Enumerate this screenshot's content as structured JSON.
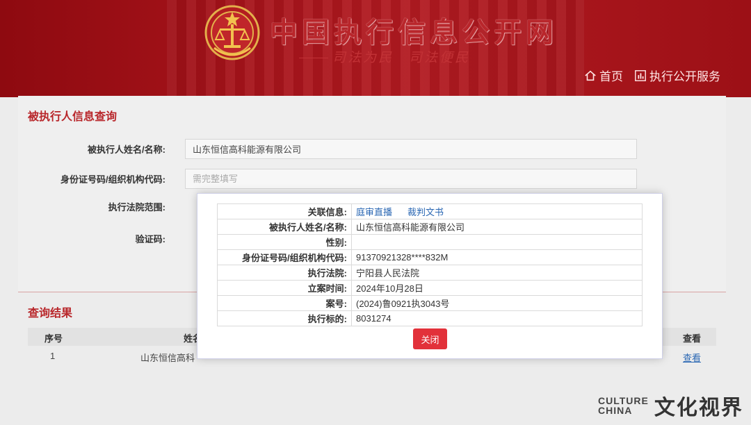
{
  "header": {
    "site_title": "中国执行信息公开网",
    "slogan": "司法为民　司法便民",
    "nav": [
      {
        "label": "首页",
        "icon": "home-icon"
      },
      {
        "label": "执行公开服务",
        "icon": "bar-chart-icon"
      }
    ]
  },
  "query": {
    "title": "被执行人信息查询",
    "fields": [
      {
        "label": "被执行人姓名/名称:",
        "value": "山东恒信高科能源有限公司",
        "placeholder": ""
      },
      {
        "label": "身份证号码/组织机构代码:",
        "value": "",
        "placeholder": "需完整填写"
      },
      {
        "label": "执行法院范围:"
      },
      {
        "label": "验证码:"
      }
    ]
  },
  "results": {
    "title": "查询结果",
    "columns": [
      "序号",
      "姓名",
      "查看"
    ],
    "rows": [
      {
        "index": "1",
        "name": "山东恒信高科",
        "view": "查看"
      }
    ]
  },
  "modal": {
    "rows": [
      {
        "key": "关联信息:",
        "links": [
          "庭审直播",
          "裁判文书"
        ]
      },
      {
        "key": "被执行人姓名/名称:",
        "value": "山东恒信高科能源有限公司"
      },
      {
        "key": "性别:",
        "value": ""
      },
      {
        "key": "身份证号码/组织机构代码:",
        "value": "91370921328****832M"
      },
      {
        "key": "执行法院:",
        "value": "宁阳县人民法院"
      },
      {
        "key": "立案时间:",
        "value": "2024年10月28日"
      },
      {
        "key": "案号:",
        "value": "(2024)鲁0921执3043号"
      },
      {
        "key": "执行标的:",
        "value": "8031274"
      }
    ],
    "close_label": "关闭"
  },
  "watermark": {
    "en_top": "CULTURE",
    "en_bottom": "CHINA",
    "zh": "文化视界"
  },
  "colors": {
    "header_red": "#a8141b",
    "accent_red": "#b8262a",
    "button_red": "#e2313a",
    "link_blue": "#2a67b3"
  }
}
